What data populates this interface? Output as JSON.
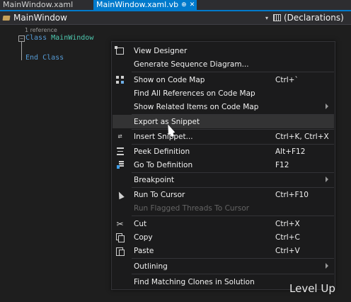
{
  "tabs": [
    {
      "label": "MainWindow.xaml",
      "active": false
    },
    {
      "label": "MainWindow.xaml.vb",
      "active": true,
      "pin": "⊕",
      "close": "✕"
    }
  ],
  "navbar": {
    "left_label": "MainWindow",
    "right_label": "(Declarations)",
    "dropdown_glyph": "▾"
  },
  "editor": {
    "reference_hint": "1 reference",
    "collapse_glyph": "−",
    "line1": {
      "keyword": "Class",
      "name": "MainWindow"
    },
    "line2": {
      "text": "End Class"
    }
  },
  "context_menu": {
    "items": [
      {
        "label": "View Designer",
        "shortcut": "",
        "icon": "designer-icon"
      },
      {
        "label": "Generate Sequence Diagram...",
        "shortcut": ""
      },
      {
        "label": "Show on Code Map",
        "shortcut": "Ctrl+`",
        "icon": "code-map-icon"
      },
      {
        "label": "Find All References on Code Map",
        "shortcut": ""
      },
      {
        "label": "Show Related Items on Code Map",
        "shortcut": "",
        "submenu": true
      },
      {
        "label": "Export as Snippet",
        "shortcut": "",
        "highlighted": true
      },
      {
        "label": "Insert Snippet...",
        "shortcut": "Ctrl+K, Ctrl+X",
        "icon": "snippet-icon"
      },
      {
        "label": "Peek Definition",
        "shortcut": "Alt+F12",
        "icon": "peek-icon"
      },
      {
        "label": "Go To Definition",
        "shortcut": "F12",
        "icon": "goto-icon"
      },
      {
        "label": "Breakpoint",
        "shortcut": "",
        "submenu": true
      },
      {
        "label": "Run To Cursor",
        "shortcut": "Ctrl+F10",
        "icon": "cursor-icon"
      },
      {
        "label": "Run Flagged Threads To Cursor",
        "shortcut": "",
        "disabled": true
      },
      {
        "label": "Cut",
        "shortcut": "Ctrl+X",
        "icon": "scissors-icon"
      },
      {
        "label": "Copy",
        "shortcut": "Ctrl+C",
        "icon": "copy-icon"
      },
      {
        "label": "Paste",
        "shortcut": "Ctrl+V",
        "icon": "paste-icon"
      },
      {
        "label": "Outlining",
        "shortcut": "",
        "submenu": true
      },
      {
        "label": "Find Matching Clones in Solution",
        "shortcut": ""
      }
    ]
  },
  "watermark": "Level Up",
  "colors": {
    "accent": "#007acc",
    "menu_bg": "#1b1b1c",
    "menu_hover": "#333334",
    "keyword": "#569cd6",
    "type": "#4ec9b0"
  }
}
